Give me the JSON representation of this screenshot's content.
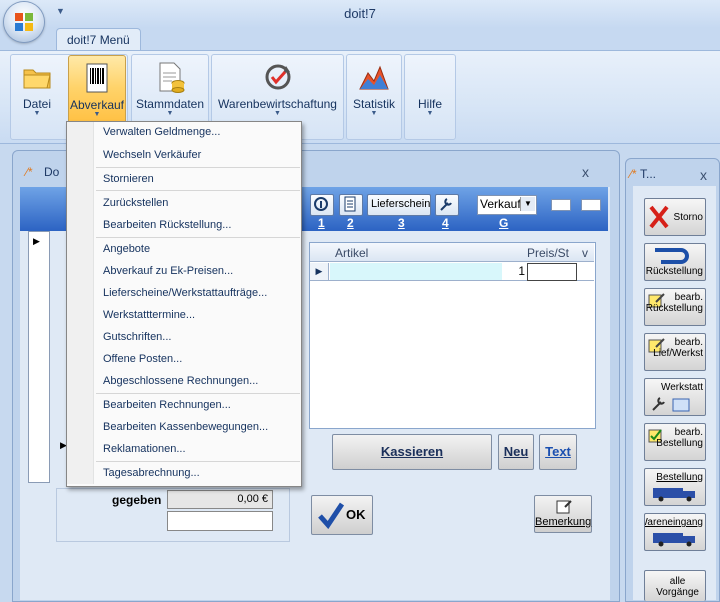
{
  "app": {
    "title": "doit!7"
  },
  "ribbon": {
    "tab_label": "doit!7 Menü",
    "buttons": [
      {
        "label": "Datei"
      },
      {
        "label": "Abverkauf"
      },
      {
        "label": "Stammdaten"
      },
      {
        "label": "Warenbewirtschaftung"
      },
      {
        "label": "Statistik"
      },
      {
        "label": "Hilfe"
      }
    ]
  },
  "menu": {
    "items": [
      "Verwalten Geldmenge...",
      "Wechseln Verkäufer",
      "Stornieren",
      "Zurückstellen",
      "Bearbeiten Rückstellung...",
      "Angebote",
      "Abverkauf zu Ek-Preisen...",
      "Lieferscheine/Werkstattaufträge...",
      "Werkstatttermine...",
      "Gutschriften...",
      "Offene Posten...",
      "Abgeschlossene Rechnungen...",
      "Bearbeiten Rechnungen...",
      "Bearbeiten Kassenbewegungen...",
      "Reklamationen...",
      "Tagesabrechnung..."
    ]
  },
  "doc_window": {
    "title": "Do",
    "close": "x",
    "toolbar": {
      "numbers": [
        "1",
        "2",
        "3",
        "4"
      ],
      "lieferschein_label": "Lieferschein",
      "select_value": "Verkauf",
      "select_hotkey": "G"
    },
    "grid": {
      "headers": {
        "artikel": "Artikel",
        "preis": "Preis/St",
        "v": "v"
      },
      "row": {
        "qty": "1"
      }
    },
    "buttons": {
      "kassieren": "Kassieren",
      "neu": "Neu",
      "text": "Text",
      "ok": "OK",
      "bemerkung": "Bemerkung"
    },
    "gegeben": {
      "label": "gegeben",
      "value": "0,00 €"
    }
  },
  "side_panel": {
    "title": "T...",
    "close": "x",
    "buttons": [
      {
        "label": "Storno"
      },
      {
        "label": "Rückstellung"
      },
      {
        "label": "bearb.\nRückstellung"
      },
      {
        "label": "bearb.\nLief/Werkst"
      },
      {
        "label": "Werkstatt"
      },
      {
        "label": "bearb.\nBestellung"
      },
      {
        "label": "Bestellung"
      },
      {
        "label": "Wareneingang"
      },
      {
        "label": "alle\nVorgänge"
      }
    ]
  }
}
